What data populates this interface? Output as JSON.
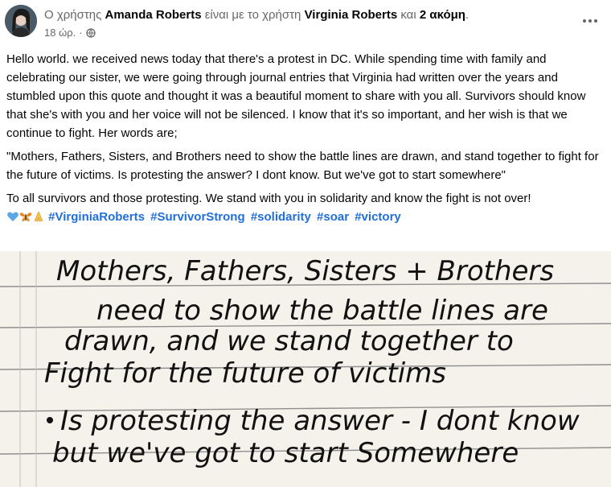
{
  "header": {
    "prefix": "Ο χρήστης",
    "author": "Amanda Roberts",
    "mid": "είναι με το χρήστη",
    "tagged": "Virginia Roberts",
    "and": "και",
    "others": "2 ακόμη",
    "period": ".",
    "time": "18 ώρ.",
    "separator": "·",
    "privacy_icon": "globe-icon"
  },
  "post": {
    "paragraph1": "Hello world. we received news today that there's a protest in DC. While spending time with family and celebrating our sister, we were going through journal entries that Virginia had written over the years and stumbled upon this quote and thought it was a beautiful moment to share with you all. Survivors should know that she's with you and her voice will not be silenced. I know that it's so important, and her wish is that we continue to fight. Her words are;",
    "paragraph2": "\"Mothers, Fathers, Sisters, and Brothers need to show the battle lines are drawn, and stand together to fight for the future of victims. Is protesting the answer? I dont know. But we've got to start somewhere\"",
    "paragraph3": "To all survivors and those protesting. We stand with you in solidarity and know the fight is not over!",
    "hashtags": [
      "#VirginiaRoberts",
      "#SurvivorStrong",
      "#solidarity",
      "#soar",
      "#victory"
    ],
    "emojis": [
      "blue-heart-emoji",
      "butterfly-emoji",
      "praying-hands-emoji"
    ]
  },
  "photo": {
    "lines": [
      "Mothers, Fathers, Sisters + Brothers",
      "need to show the battle lines are",
      "drawn, and we stand together to",
      "Fight for the future of victims",
      "Is protesting the answer - I dont know",
      "but we've got to start Somewhere"
    ]
  },
  "colors": {
    "link": "#216fdb",
    "muted": "#65676b",
    "text": "#050505"
  }
}
